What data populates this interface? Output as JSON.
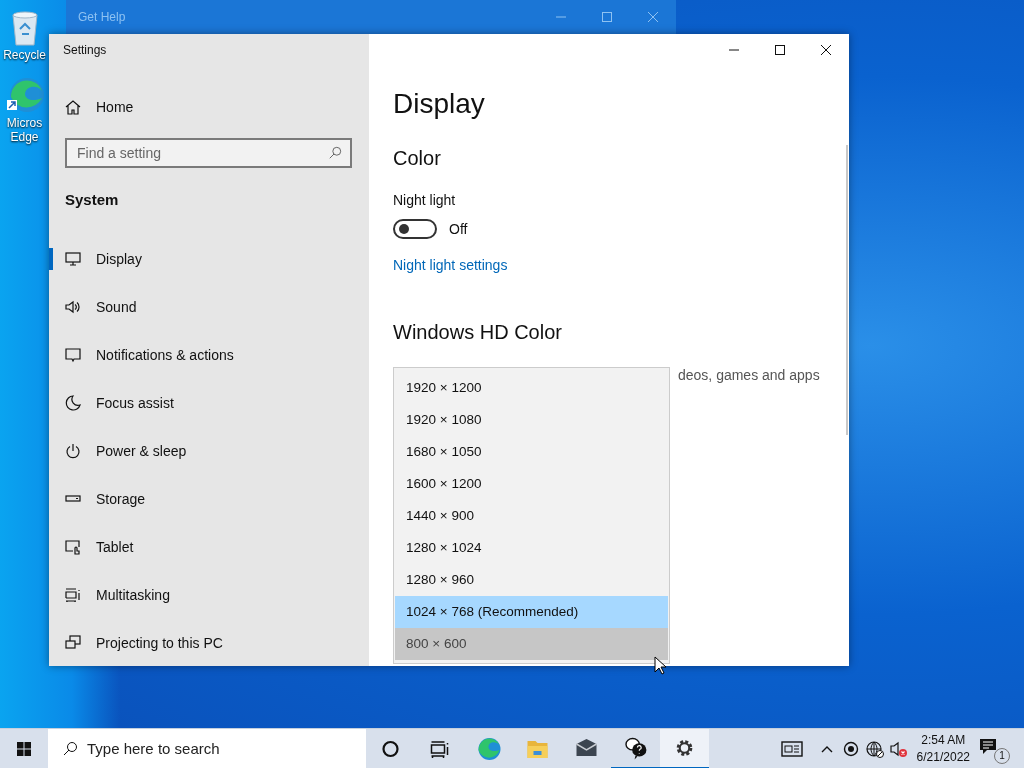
{
  "desktop_icons": [
    {
      "kind": "recycle_bin",
      "label": "Recycle"
    },
    {
      "kind": "edge",
      "label": "Micros Edge"
    }
  ],
  "background_window": {
    "title": "Get Help"
  },
  "settings": {
    "title": "Settings",
    "home": "Home",
    "search": {
      "placeholder": "Find a setting"
    },
    "section": "System",
    "nav": [
      {
        "kind": "display",
        "label": "Display",
        "selected": true
      },
      {
        "kind": "sound",
        "label": "Sound",
        "selected": false
      },
      {
        "kind": "notifications",
        "label": "Notifications & actions",
        "selected": false
      },
      {
        "kind": "focus",
        "label": "Focus assist",
        "selected": false
      },
      {
        "kind": "power",
        "label": "Power & sleep",
        "selected": false
      },
      {
        "kind": "storage",
        "label": "Storage",
        "selected": false
      },
      {
        "kind": "tablet",
        "label": "Tablet",
        "selected": false
      },
      {
        "kind": "multitasking",
        "label": "Multitasking",
        "selected": false
      },
      {
        "kind": "projecting",
        "label": "Projecting to this PC",
        "selected": false
      }
    ],
    "page_title": "Display",
    "color_heading": "Color",
    "night_light": {
      "label": "Night light",
      "on": false,
      "state_text": "Off"
    },
    "night_light_link": "Night light settings",
    "hd_heading": "Windows HD Color",
    "hd_text": "deos, games and apps",
    "resolution_menu": [
      {
        "label": "1920 × 1200",
        "selected": false,
        "hovered": false
      },
      {
        "label": "1920 × 1080",
        "selected": false,
        "hovered": false
      },
      {
        "label": "1680 × 1050",
        "selected": false,
        "hovered": false
      },
      {
        "label": "1600 × 1200",
        "selected": false,
        "hovered": false
      },
      {
        "label": "1440 × 900",
        "selected": false,
        "hovered": false
      },
      {
        "label": "1280 × 1024",
        "selected": false,
        "hovered": false
      },
      {
        "label": "1280 × 960",
        "selected": false,
        "hovered": false
      },
      {
        "label": "1024 × 768 (Recommended)",
        "selected": true,
        "hovered": false
      },
      {
        "label": "800 × 600",
        "selected": false,
        "hovered": true
      }
    ]
  },
  "taskbar": {
    "search_placeholder": "Type here to search",
    "apps": [
      {
        "kind": "cortana",
        "running": false,
        "active": false
      },
      {
        "kind": "task_view",
        "running": false,
        "active": false
      },
      {
        "kind": "edge",
        "running": false,
        "active": false
      },
      {
        "kind": "file_explorer",
        "running": false,
        "active": false
      },
      {
        "kind": "mail",
        "running": false,
        "active": false
      },
      {
        "kind": "get_help",
        "running": true,
        "active": false
      },
      {
        "kind": "settings",
        "running": true,
        "active": true
      }
    ],
    "tray_icons": [
      {
        "kind": "news"
      },
      {
        "kind": "chevron"
      },
      {
        "kind": "record"
      },
      {
        "kind": "network"
      },
      {
        "kind": "volume_muted"
      }
    ],
    "time": "2:54 AM",
    "date": "6/21/2022",
    "notification_count": "1"
  }
}
